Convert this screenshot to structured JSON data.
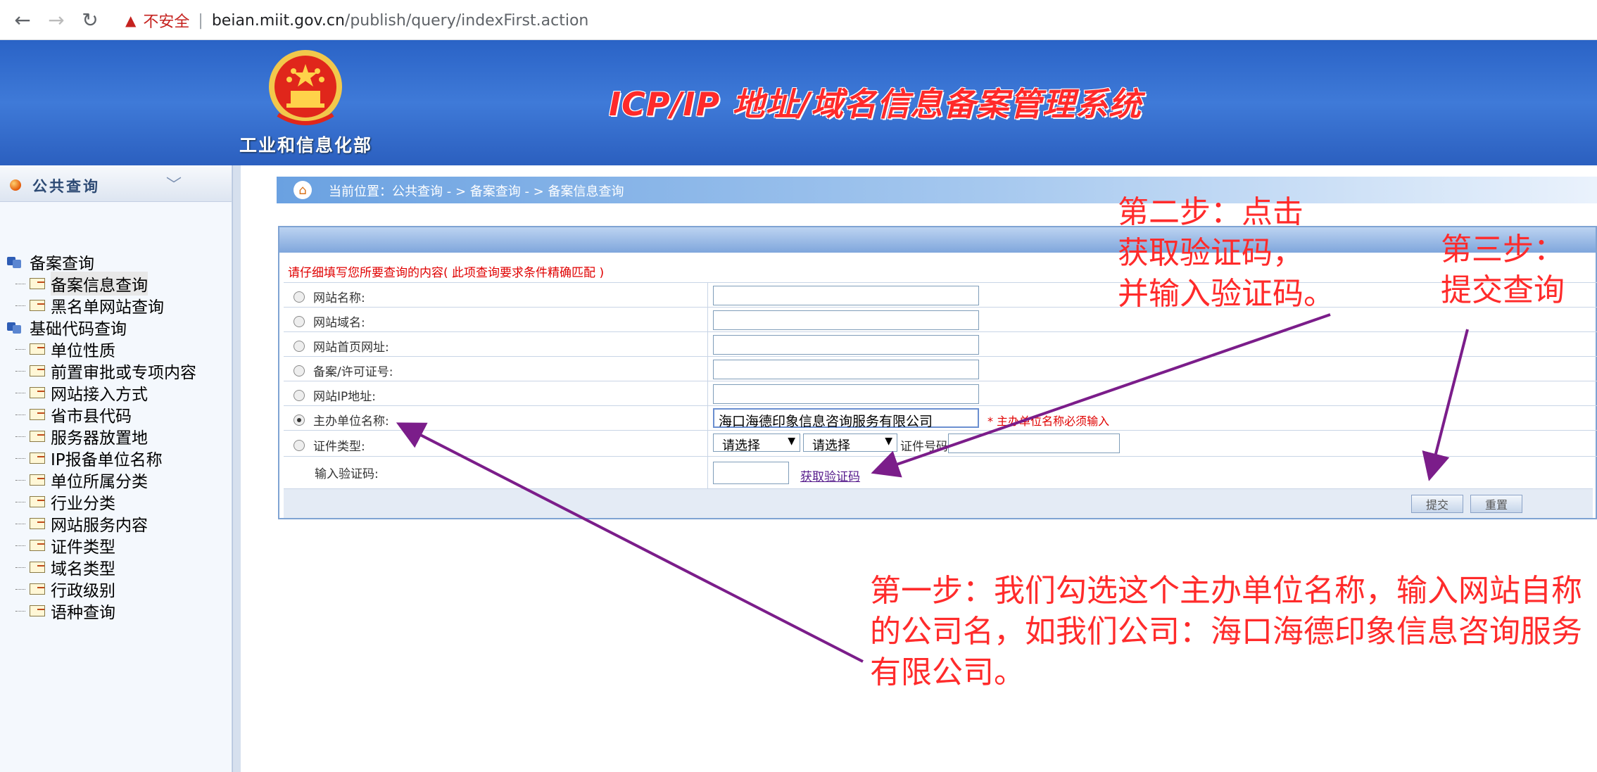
{
  "browser": {
    "insecure_label": "不安全",
    "url_host": "beian.miit.gov.cn",
    "url_path": "/publish/query/indexFirst.action"
  },
  "header": {
    "ministry": "工业和信息化部",
    "system_title": "ICP/IP 地址/域名信息备案管理系统"
  },
  "sidebar": {
    "title": "公共查询",
    "group1": "备案查询",
    "group1_items": [
      "备案信息查询",
      "黑名单网站查询"
    ],
    "group2": "基础代码查询",
    "group2_items": [
      "单位性质",
      "前置审批或专项内容",
      "网站接入方式",
      "省市县代码",
      "服务器放置地",
      "IP报备单位名称",
      "单位所属分类",
      "行业分类",
      "网站服务内容",
      "证件类型",
      "域名类型",
      "行政级别",
      "语种查询"
    ]
  },
  "breadcrumb": "当前位置：公共查询  - >  备案查询  - > 备案信息查询",
  "form": {
    "hint": "请仔细填写您所要查询的内容( 此项查询要求条件精确匹配 )",
    "labels": [
      "网站名称:",
      "网站域名:",
      "网站首页网址:",
      "备案/许可证号:",
      "网站IP地址:",
      "主办单位名称:",
      "证件类型:"
    ],
    "captcha_label": "输入验证码:",
    "unit_name_value": "海口海德印象信息咨询服务有限公司",
    "unit_required": "* 主办单位名称必须输入",
    "select1": "请选择",
    "select2": "请选择",
    "cert_no_label": "证件号码:",
    "get_captcha": "获取验证码",
    "submit": "提交",
    "reset": "重置"
  },
  "annotations": {
    "step1": "第一步：我们勾选这个主办单位名称，输入网站自称的公司名，如我们公司：海口海德印象信息咨询服务有限公司。",
    "step1_lines": [
      "第一步：我们勾选这个主办单位名称，输入网站自称",
      "的公司名，如我们公司：海口海德印象信息咨询服务",
      "有限公司。"
    ],
    "step2_lines": [
      "第二步：点击",
      "获取验证码，",
      "并输入验证码。"
    ],
    "step3_lines": [
      "第三步：",
      "提交查询"
    ],
    "color": "#ff2b2b",
    "arrow_color": "#7b1d8a"
  }
}
